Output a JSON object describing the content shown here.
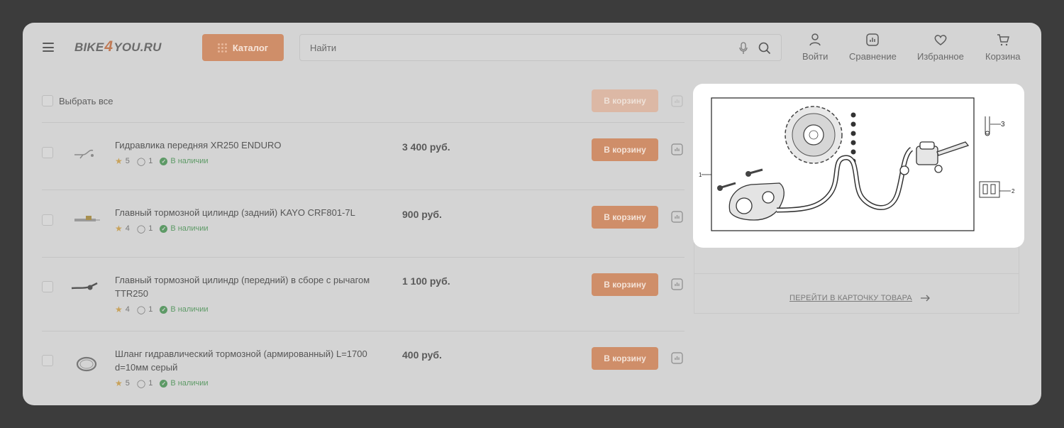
{
  "header": {
    "logo": {
      "part1": "BIKE",
      "four": "4",
      "part2": "YOU.RU"
    },
    "catalog_label": "Каталог",
    "search_placeholder": "Найти",
    "nav": [
      {
        "label": "Войти",
        "icon": "user-icon"
      },
      {
        "label": "Сравнение",
        "icon": "compare-icon"
      },
      {
        "label": "Избранное",
        "icon": "heart-icon"
      },
      {
        "label": "Корзина",
        "icon": "cart-icon"
      }
    ]
  },
  "list": {
    "select_all_label": "Выбрать все",
    "bulk_cart_label": "В корзину"
  },
  "products": [
    {
      "title": "Гидравлика передняя XR250 ENDURO",
      "rating": "5",
      "comments": "1",
      "availability": "В наличии",
      "price": "3 400 руб.",
      "button": "В корзину"
    },
    {
      "title": "Главный тормозной цилиндр (задний) KAYO CRF801-7L",
      "rating": "4",
      "comments": "1",
      "availability": "В наличии",
      "price": "900 руб.",
      "button": "В корзину"
    },
    {
      "title": "Главный тормозной цилиндр (передний) в сборе с рычагом TTR250",
      "rating": "4",
      "comments": "1",
      "availability": "В наличии",
      "price": "1 100 руб.",
      "button": "В корзину"
    },
    {
      "title": "Шланг гидравлический тормозной (армированный) L=1700 d=10мм серый",
      "rating": "5",
      "comments": "1",
      "availability": "В наличии",
      "price": "400 руб.",
      "button": "В корзину"
    }
  ],
  "detail": {
    "goto_label": "ПЕРЕЙТИ В КАРТОЧКУ ТОВАРА"
  },
  "popup": {
    "callouts": {
      "one": "1",
      "two": "2",
      "three": "3"
    }
  },
  "colors": {
    "accent": "#cf8e69",
    "backdrop": "#3c3c3c",
    "availability": "#5d9a66"
  }
}
